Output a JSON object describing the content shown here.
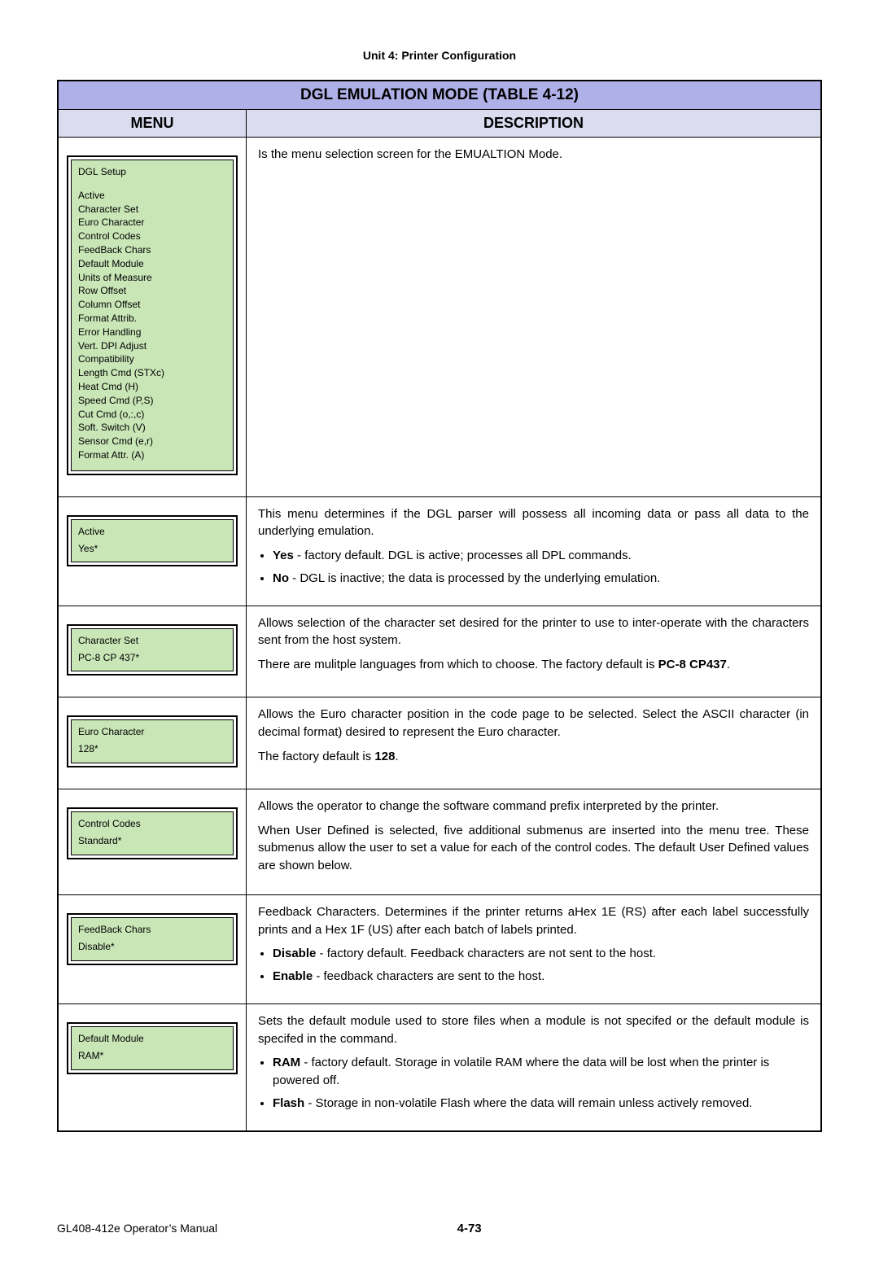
{
  "header": "Unit 4:  Printer Configuration",
  "table_title": "DGL EMULATION MODE (TABLE 4-12)",
  "col_menu": "MENU",
  "col_desc": "DESCRIPTION",
  "row1": {
    "panel_title": "DGL Setup",
    "items": [
      "Active",
      "Character Set",
      "Euro Character",
      "Control Codes",
      "FeedBack Chars",
      "Default Module",
      "Units of Measure",
      "Row Offset",
      "Column Offset",
      "Format Attrib.",
      "Error Handling",
      "Vert. DPI Adjust",
      "Compatibility",
      "Length Cmd (STXc)",
      "Heat Cmd (H)",
      "Speed Cmd (P,S)",
      "Cut Cmd (o,:,c)",
      "Soft. Switch (V)",
      "Sensor Cmd (e,r)",
      "Format Attr. (A)"
    ],
    "desc": "Is the menu selection screen for the EMUALTION Mode."
  },
  "row2": {
    "label": "Active",
    "value": "Yes*",
    "p1": "This menu determines if the DGL parser will possess all incoming data or pass all data to the underlying emulation.",
    "b1a": "Yes",
    "b1b": " - factory default. DGL is active; processes all DPL commands.",
    "b2a": "No",
    "b2b": " - DGL is inactive; the data is processed by the underlying emulation."
  },
  "row3": {
    "label": "Character Set",
    "value": "PC-8 CP 437*",
    "p1": "Allows selection of the character set desired for the printer to use to inter-operate with the characters sent from the host system.",
    "p2a": "There are mulitple languages from which to choose. The factory default is ",
    "p2b": "PC-8 CP437",
    "p2c": "."
  },
  "row4": {
    "label": "Euro Character",
    "value": "128*",
    "p1": "Allows the Euro character position in the code page to be selected. Select the ASCII character (in decimal format) desired to represent the Euro character.",
    "p2a": "The factory default is ",
    "p2b": "128",
    "p2c": "."
  },
  "row5": {
    "label": "Control Codes",
    "value": "Standard*",
    "p1": "Allows the operator to change the software command prefix interpreted by the printer.",
    "p2": "When User Defined is selected, five additional submenus are inserted into the menu tree. These submenus allow the user to set a value for each of the control codes. The default User Defined values are shown below."
  },
  "row6": {
    "label": "FeedBack Chars",
    "value": "Disable*",
    "p1": "Feedback Characters. Determines if the printer returns aHex 1E (RS) after each label successfully prints and a Hex 1F (US) after each batch of labels printed.",
    "b1a": "Disable",
    "b1b": " - factory default. Feedback characters are not sent to the host.",
    "b2a": "Enable",
    "b2b": " - feedback characters are sent to the host."
  },
  "row7": {
    "label": "Default Module",
    "value": "RAM*",
    "p1": "Sets the default module used to store files when a module is not specifed or the default module is specifed in the command.",
    "b1a": "RAM",
    "b1b": " - factory default. Storage in volatile RAM where the data will be lost when the printer is powered off.",
    "b2a": "Flash",
    "b2b": " - Storage in non-volatile Flash where the data will remain unless actively removed."
  },
  "footer_left": "GL408-412e Operator’s Manual",
  "footer_page": "4-73"
}
